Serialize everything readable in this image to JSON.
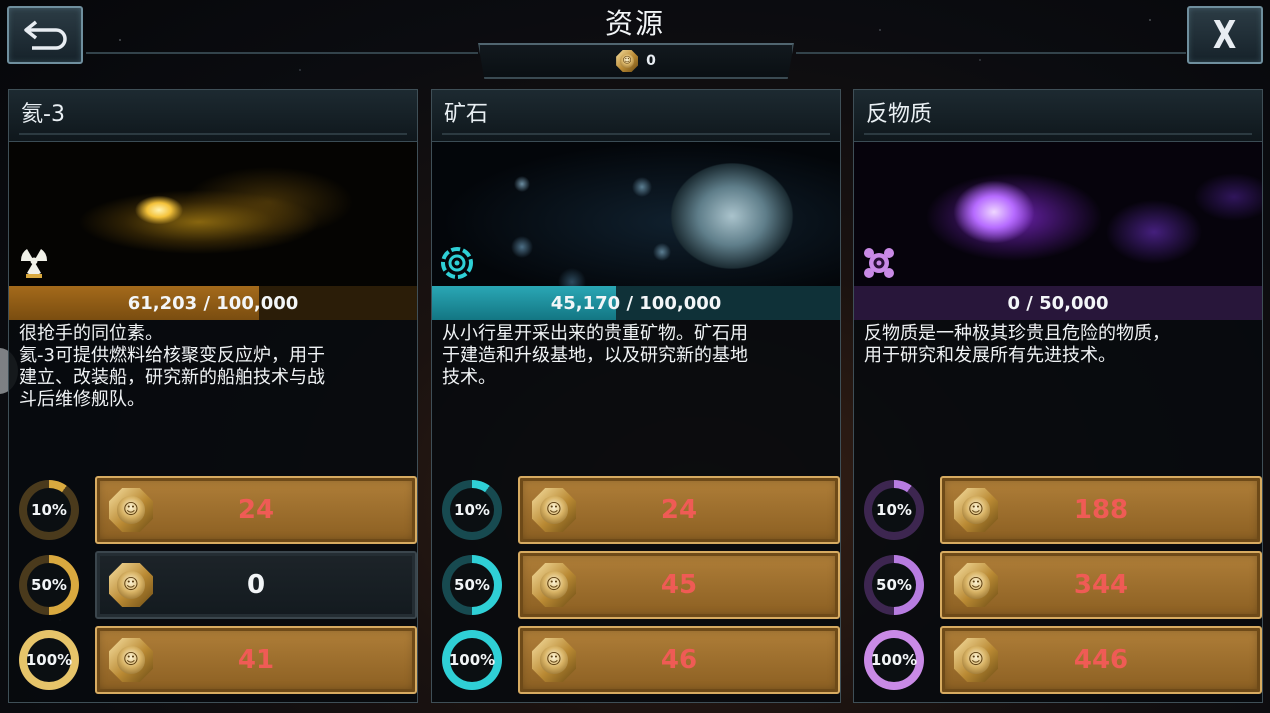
{
  "header": {
    "title": "资源",
    "currency_value": "0"
  },
  "colors": {
    "helium": "#d9a93f",
    "ore": "#2fd0d6",
    "antimatter": "#b77ce0",
    "price_red": "#ef5b55"
  },
  "panels": [
    {
      "name": "氦-3",
      "progress_text": "61,203 / 100,000",
      "progress_fraction": 0.612,
      "description": "很抢手的同位素。\n氦-3可提供燃料给核聚变反应炉，用于\n建立、改装船，研究新的船舶技术与战\n斗后维修舰队。",
      "icon": "radiation-icon",
      "options": [
        {
          "percent": "10%",
          "price": "24",
          "enabled": true
        },
        {
          "percent": "50%",
          "price": "0",
          "enabled": false
        },
        {
          "percent": "100%",
          "price": "41",
          "enabled": true
        }
      ]
    },
    {
      "name": "矿石",
      "progress_text": "45,170 / 100,000",
      "progress_fraction": 0.452,
      "description": "从小行星开采出来的贵重矿物。矿石用\n于建造和升级基地，以及研究新的基地\n技术。",
      "icon": "ore-target-icon",
      "options": [
        {
          "percent": "10%",
          "price": "24",
          "enabled": true
        },
        {
          "percent": "50%",
          "price": "45",
          "enabled": true
        },
        {
          "percent": "100%",
          "price": "46",
          "enabled": true
        }
      ]
    },
    {
      "name": "反物质",
      "progress_text": "0 / 50,000",
      "progress_fraction": 0.0,
      "description": "反物质是一种极其珍贵且危险的物质，\n用于研究和发展所有先进技术。",
      "icon": "antimatter-icon",
      "options": [
        {
          "percent": "10%",
          "price": "188",
          "enabled": true
        },
        {
          "percent": "50%",
          "price": "344",
          "enabled": true
        },
        {
          "percent": "100%",
          "price": "446",
          "enabled": true
        }
      ]
    }
  ]
}
